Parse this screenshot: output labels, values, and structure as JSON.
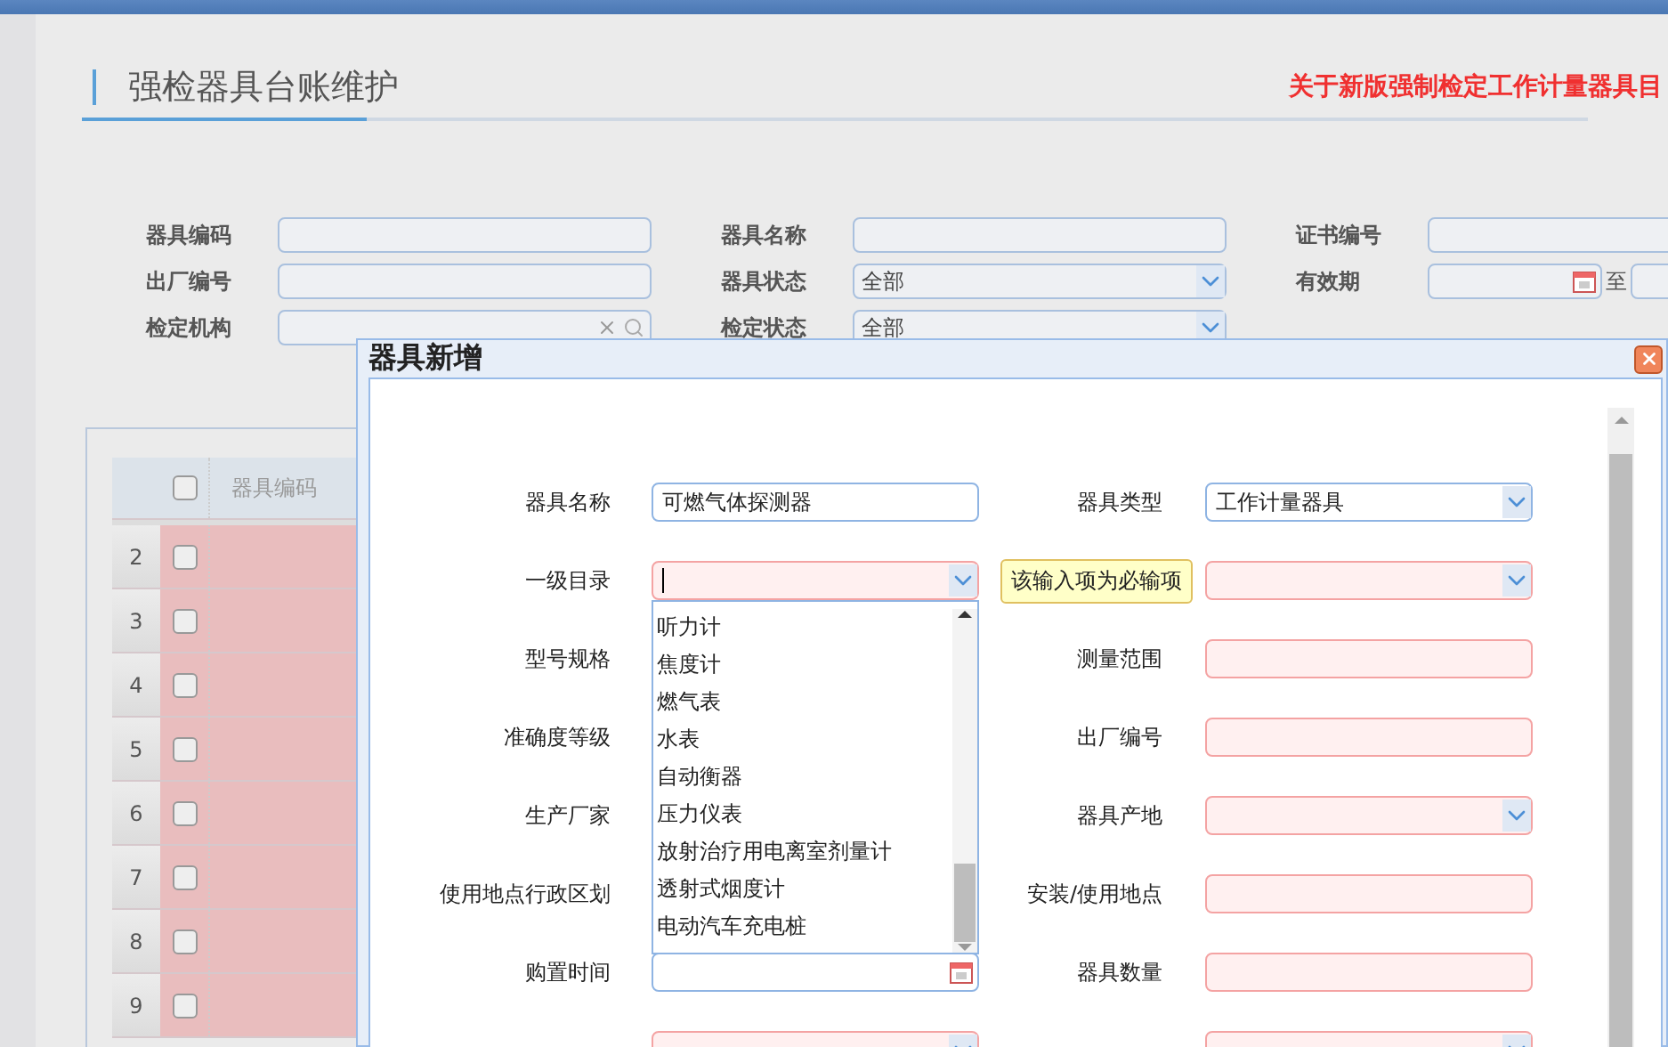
{
  "page": {
    "title": "强检器具台账维护",
    "notice": "关于新版强制检定工作计量器具目"
  },
  "filters": [
    {
      "label": "器具编码",
      "kind": "text"
    },
    {
      "label": "器具名称",
      "kind": "text"
    },
    {
      "label": "证书编号",
      "kind": "text"
    },
    {
      "label": "出厂编号",
      "kind": "text"
    },
    {
      "label": "器具状态",
      "kind": "select",
      "value": "全部"
    },
    {
      "label": "有效期",
      "kind": "daterange",
      "separator": "至"
    },
    {
      "label": "检定机构",
      "kind": "lookup"
    },
    {
      "label": "检定状态",
      "kind": "select",
      "value": "全部"
    }
  ],
  "table": {
    "columns": [
      "器具编码"
    ],
    "header_checked": false,
    "rows": [
      {
        "number": "2",
        "checked": false
      },
      {
        "number": "3",
        "checked": false
      },
      {
        "number": "4",
        "checked": false
      },
      {
        "number": "5",
        "checked": false
      },
      {
        "number": "6",
        "checked": false
      },
      {
        "number": "7",
        "checked": false
      },
      {
        "number": "8",
        "checked": false
      },
      {
        "number": "9",
        "checked": false
      }
    ]
  },
  "dialog": {
    "title": "器具新增",
    "fields": [
      {
        "label": "器具名称",
        "kind": "text",
        "value": "可燃气体探测器",
        "invalid": false
      },
      {
        "label": "器具类型",
        "kind": "select",
        "value": "工作计量器具",
        "invalid": false
      },
      {
        "label": "一级目录",
        "kind": "select",
        "invalid": true,
        "focused": true,
        "tooltip": "该输入项为必输项",
        "options": [
          "听力计",
          "焦度计",
          "燃气表",
          "水表",
          "自动衡器",
          "压力仪表",
          "放射治疗用电离室剂量计",
          "透射式烟度计",
          "电动汽车充电桩"
        ]
      },
      {
        "kind": "select",
        "invalid": true
      },
      {
        "label": "型号规格"
      },
      {
        "label": "测量范围",
        "kind": "text",
        "invalid": true
      },
      {
        "label": "准确度等级"
      },
      {
        "label": "出厂编号",
        "kind": "text",
        "invalid": true
      },
      {
        "label": "生产厂家"
      },
      {
        "label": "器具产地",
        "kind": "select",
        "invalid": true
      },
      {
        "label": "使用地点行政区划"
      },
      {
        "label": "安装/使用地点",
        "kind": "text",
        "invalid": true
      },
      {
        "label": "购置时间",
        "kind": "date",
        "invalid": false
      },
      {
        "label": "器具数量",
        "kind": "text",
        "invalid": true
      },
      {
        "kind": "select",
        "invalid": true
      },
      {
        "kind": "select",
        "invalid": true
      }
    ]
  }
}
